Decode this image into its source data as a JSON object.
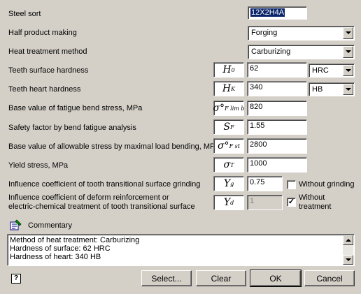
{
  "rows": {
    "steel_sort": {
      "label": "Steel sort",
      "value": "12X2H4A"
    },
    "half_product": {
      "label": "Half product making",
      "value": "Forging"
    },
    "heat_treatment": {
      "label": "Heat treatment method",
      "value": "Carburizing"
    },
    "surface_hardness": {
      "label": "Teeth surface hardness",
      "symbol": "H",
      "sub": "0",
      "value": "62",
      "unit": "HRC"
    },
    "heart_hardness": {
      "label": "Teeth heart hardness",
      "symbol": "H",
      "sub": "K",
      "value": "340",
      "unit": "HB"
    },
    "fatigue_bend": {
      "label": "Base value of fatigue bend stress, MPa",
      "symbol": "σ°",
      "sub": "F lim b",
      "value": "820"
    },
    "safety_factor": {
      "label": "Safety factor by bend fatigue analysis",
      "symbol": "S",
      "sub": "F",
      "value": "1.55"
    },
    "allowable_stress": {
      "label": "Base value of allowable stress by maximal load bending, MPa",
      "symbol": "σ°",
      "sub": "F st",
      "value": "2800"
    },
    "yield_stress": {
      "label": "Yield stress, MPa",
      "symbol": "σ",
      "sub": "T",
      "value": "1000"
    },
    "grinding": {
      "label": "Influence coefficient of tooth transitional surface grinding",
      "symbol": "Y",
      "sub": "g",
      "value": "0.75",
      "check_label": "Without grinding",
      "checked": false
    },
    "deform": {
      "label_line1": "Influence coefficient of deform reinforcement or",
      "label_line2": "electric-chemical treatment of tooth transitional surface",
      "symbol": "Y",
      "sub": "d",
      "value": "1",
      "check_label_line1": "Without",
      "check_label_line2": "treatment",
      "checked": true,
      "check_mark": "✓"
    }
  },
  "commentary": {
    "title": "Commentary",
    "lines": [
      "Method of heat treatment: Carburizing",
      "Hardness of surface: 62 HRC",
      "Hardness of heart: 340 HB"
    ]
  },
  "buttons": {
    "select": "Select...",
    "clear": "Clear",
    "ok": "OK",
    "cancel": "Cancel"
  },
  "help": {
    "glyph": "?"
  }
}
